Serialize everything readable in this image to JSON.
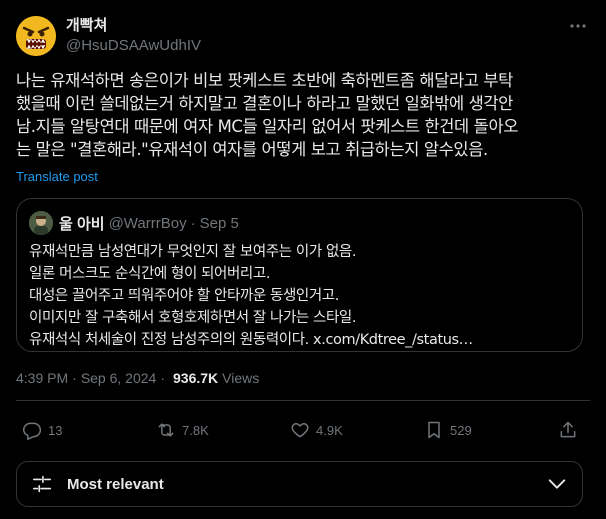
{
  "author": {
    "display_name": "개빡쳐",
    "handle": "@HsuDSAAwUdhIV"
  },
  "tweet": {
    "text": "나는 유재석하면 송은이가 비보 팟케스트 초반에 축하멘트좀 해달라고 부탁\n했을때 이런 쓸데없는거 하지말고 결혼이나 하라고 말했던 일화밖에 생각안\n남.지들 알탕연대 때문에 여자 MC들 일자리 없어서 팟케스트 한건데 돌아오\n는 말은 \"결혼해라.\"유재석이 여자를 어떻게 보고 취급하는지 알수있음.",
    "translate_label": "Translate post"
  },
  "quote": {
    "name": "울 아비",
    "handle": "@WarrrBoy",
    "separator": "·",
    "date": "Sep 5",
    "text": "유재석만큼 남성연대가 무엇인지 잘 보여주는 이가 없음.\n일론 머스크도 순식간에 형이 되어버리고.\n대성은 끌어주고 띄워주어야 할 안타까운 동생인거고.\n이미지만 잘 구축해서 호형호제하면서 잘 나가는 스타일.\n유재석식 처세술이 진정 남성주의의 원동력이다. x.com/Kdtree_/status…"
  },
  "meta": {
    "time": "4:39 PM",
    "separator": "·",
    "date": "Sep 6, 2024",
    "views_count": "936.7K",
    "views_label": "Views"
  },
  "actions": {
    "replies": "13",
    "reposts": "7.8K",
    "likes": "4.9K",
    "bookmarks": "529"
  },
  "sort": {
    "label": "Most relevant"
  },
  "icons": {
    "more": "more-dots-icon",
    "reply": "reply-icon",
    "repost": "repost-icon",
    "like": "heart-icon",
    "bookmark": "bookmark-icon",
    "share": "share-icon",
    "sort": "sliders-icon",
    "chevron": "chevron-down-icon"
  },
  "colors": {
    "background": "#000000",
    "text": "#e7e9ea",
    "muted": "#71767b",
    "accent": "#1d9bf0",
    "border": "#2f3336"
  }
}
